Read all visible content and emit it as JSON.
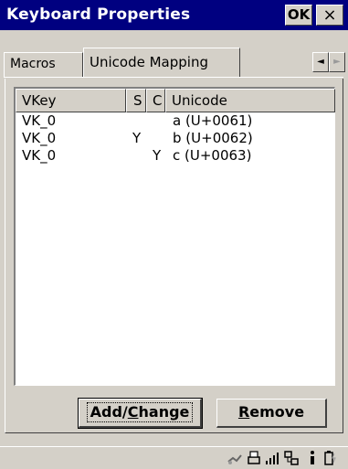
{
  "window": {
    "title": "Keyboard Properties",
    "ok_label": "OK",
    "close_label": "×"
  },
  "tabs": [
    {
      "label": "Macros"
    },
    {
      "label": "Unicode Mapping"
    }
  ],
  "tab_scroll": {
    "left": "◄",
    "right": "►"
  },
  "table": {
    "columns": [
      "VKey",
      "S",
      "C",
      "Unicode"
    ],
    "rows": [
      {
        "vkey": "VK_0",
        "s": "",
        "c": "",
        "unicode": "a (U+0061)"
      },
      {
        "vkey": "VK_0",
        "s": "Y",
        "c": "",
        "unicode": "b (U+0062)"
      },
      {
        "vkey": "VK_0",
        "s": "",
        "c": "Y",
        "unicode": "c (U+0063)"
      }
    ]
  },
  "buttons": {
    "add_change": {
      "pre": "Add/",
      "underline": "C",
      "post": "hange"
    },
    "remove": {
      "pre": "",
      "underline": "R",
      "post": "emove"
    }
  },
  "colors": {
    "titlebar": "#000080",
    "face": "#d4d0c8"
  },
  "taskbar_icons": [
    "network-icon",
    "printer-icon",
    "signal-icon",
    "connection-icon",
    "info-icon",
    "battery-icon"
  ]
}
